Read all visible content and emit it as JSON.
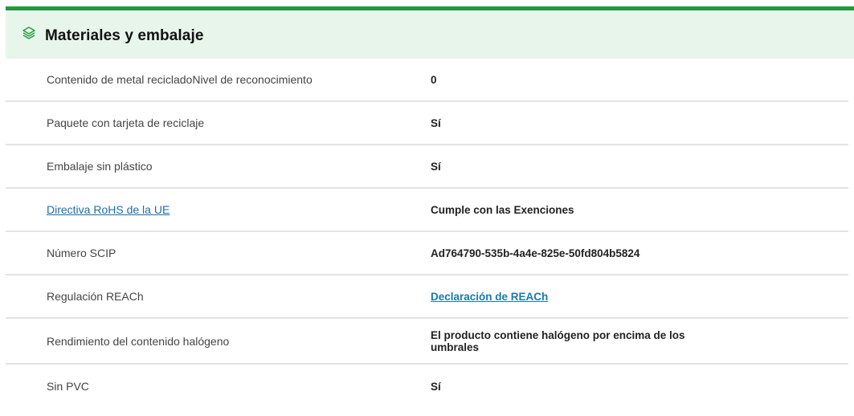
{
  "section": {
    "title": "Materiales y embalaje",
    "icon": "layers-icon",
    "accent_color": "#1e9a3c",
    "header_bg": "#e7f5ea"
  },
  "rows": [
    {
      "label": "Contenido de metal recicladoNivel de reconocimiento",
      "value": "0"
    },
    {
      "label": "Paquete con tarjeta de reciclaje",
      "value": "Sí"
    },
    {
      "label": "Embalaje sin plástico",
      "value": "Sí"
    },
    {
      "label": "Directiva RoHS de la UE",
      "value": "Cumple con las Exenciones"
    },
    {
      "label": "Número SCIP",
      "value": "Ad764790-535b-4a4e-825e-50fd804b5824"
    },
    {
      "label": "Regulación REACh",
      "value": "Declaración de REACh"
    },
    {
      "label": "Rendimiento del contenido halógeno",
      "value": "El producto contiene halógeno por encima de los umbrales"
    },
    {
      "label": "Sin PVC",
      "value": "Sí"
    }
  ],
  "link_color": "#1a79b0"
}
